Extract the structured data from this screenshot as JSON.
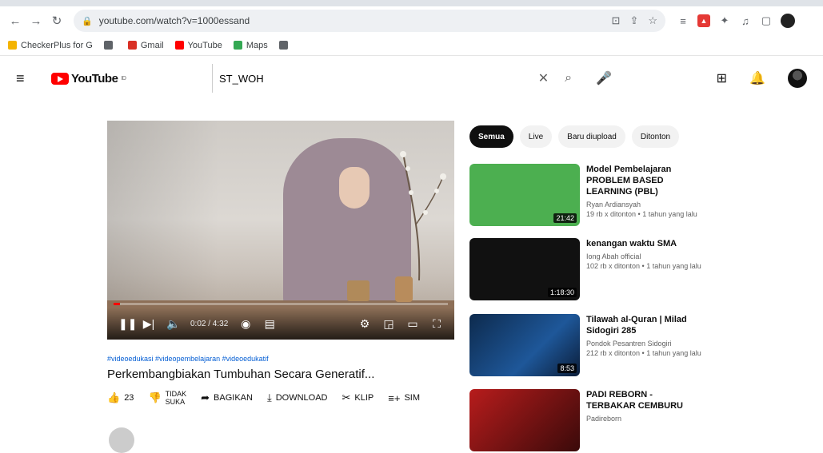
{
  "browser": {
    "url": "youtube.com/watch?v=1000essand",
    "bookmarks": [
      {
        "label": "CheckerPlus for G",
        "icon": "bookmark-icon",
        "color": "#f4b400"
      },
      {
        "label": "",
        "icon": "chrome-icon",
        "color": "#5f6368"
      },
      {
        "label": "Gmail",
        "icon": "gmail-icon",
        "color": "#d93025"
      },
      {
        "label": "YouTube",
        "icon": "youtube-icon",
        "color": "#ff0000"
      },
      {
        "label": "Maps",
        "icon": "maps-icon",
        "color": "#34a853"
      },
      {
        "label": "",
        "icon": "globe-icon",
        "color": "#5f6368"
      }
    ]
  },
  "youtube": {
    "search_value": "ST_WOH",
    "logo_text": "YouTube",
    "logo_region": "ID",
    "player": {
      "time": "0:02 / 4:32",
      "progress": 0.02
    },
    "hashtags": "#videoedukasi #videopembelajaran #videoedukatif",
    "title": "Perkembangbiakan Tumbuhan Secara Generatif...",
    "actions": {
      "like_count": "23",
      "dislike_label_1": "TIDAK",
      "dislike_label_2": "SUKA",
      "share": "BAGIKAN",
      "download": "DOWNLOAD",
      "clip": "KLIP",
      "save": "SIM"
    },
    "chips": [
      "Semua",
      "Live",
      "Baru diupload",
      "Ditonton"
    ],
    "recommendations": [
      {
        "title": "Model Pembelajaran PROBLEM BASED LEARNING (PBL)",
        "channel": "Ryan Ardiansyah",
        "meta": "19 rb x ditonton • 1 tahun yang lalu",
        "duration": "21:42"
      },
      {
        "title": "kenangan waktu SMA",
        "channel": "Iong Abah official",
        "meta": "102 rb x ditonton • 1 tahun yang lalu",
        "duration": "1:18:30"
      },
      {
        "title": "Tilawah al-Quran | Milad Sidogiri 285",
        "channel": "Pondok Pesantren Sidogiri",
        "meta": "212 rb x ditonton • 1 tahun yang lalu",
        "duration": "8:53"
      },
      {
        "title": "PADI REBORN - TERBAKAR CEMBURU",
        "channel": "Padireborn",
        "meta": "",
        "duration": ""
      }
    ]
  }
}
